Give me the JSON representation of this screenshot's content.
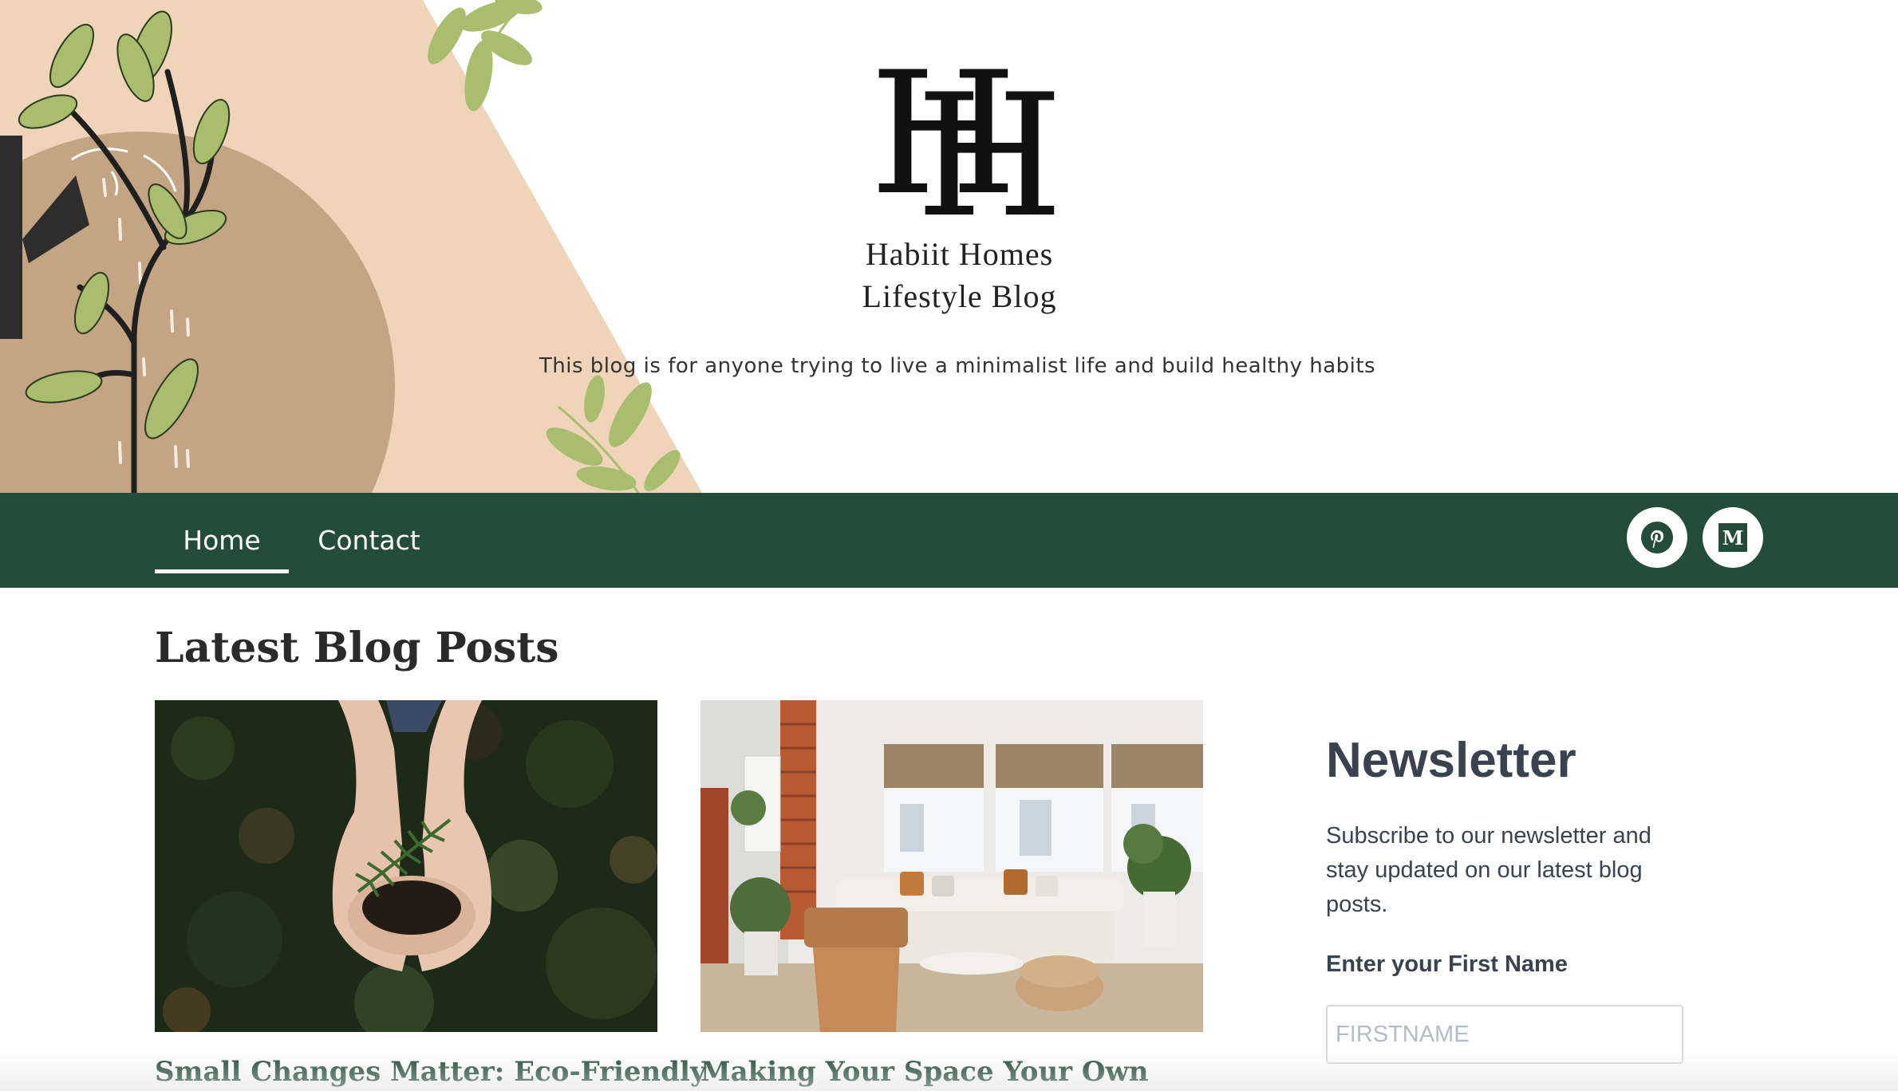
{
  "header": {
    "logo_letters": "HH",
    "site_title_line1": "Habiit Homes",
    "site_title_line2": "Lifestyle Blog",
    "tagline": "This blog is for anyone trying to live a minimalist life and build healthy habits"
  },
  "nav": {
    "items": [
      {
        "label": "Home",
        "active": true
      },
      {
        "label": "Contact",
        "active": false
      }
    ],
    "social": [
      {
        "icon": "pinterest-icon",
        "glyph": "P"
      },
      {
        "icon": "medium-icon",
        "glyph": "M"
      }
    ],
    "color": "#234d3a"
  },
  "main": {
    "section_title": "Latest Blog Posts",
    "posts": [
      {
        "title": "Small Changes Matter: Eco-Friendly",
        "image": "hands-holding-plant-image"
      },
      {
        "title": "Making Your Space Your Own",
        "image": "living-room-interior-image"
      }
    ]
  },
  "newsletter": {
    "heading": "Newsletter",
    "description": "Subscribe to our newsletter and stay updated on our latest blog posts.",
    "field_label": "Enter your First Name",
    "field_placeholder": "FIRSTNAME",
    "field_value": ""
  }
}
